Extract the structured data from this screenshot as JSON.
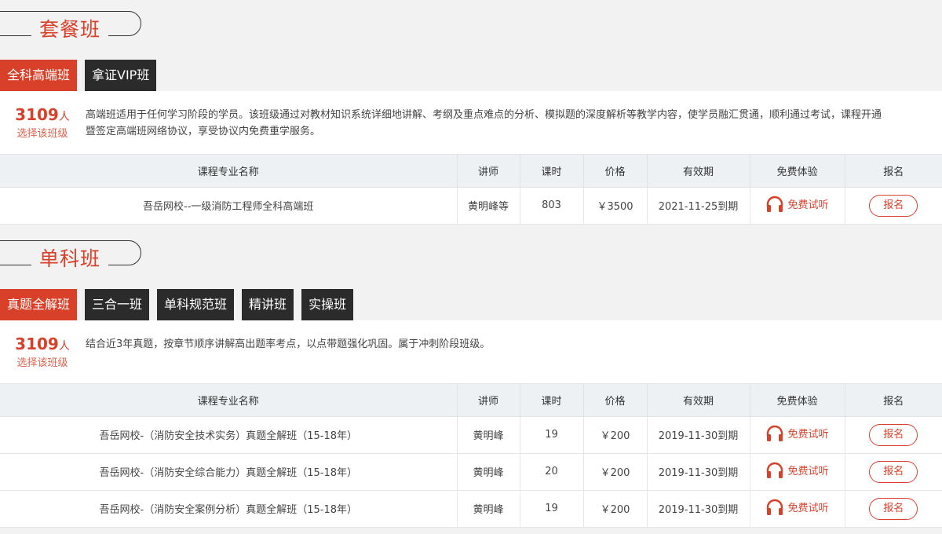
{
  "package_section": {
    "title": "套餐班",
    "tabs": [
      {
        "label": "全科高端班",
        "active": true
      },
      {
        "label": "拿证VIP班",
        "active": false
      }
    ],
    "count": "3109",
    "count_unit": "人",
    "count_sub": "选择该班级",
    "description": "高端班适用于任何学习阶段的学员。该班级通过对教材知识系统详细地讲解、考纲及重点难点的分析、模拟题的深度解析等教学内容，使学员融汇贯通，顺利通过考试，课程开通暨签定高端班网络协议，享受协议内免费重学服务。",
    "headers": [
      "课程专业名称",
      "讲师",
      "课时",
      "价格",
      "有效期",
      "免费体验",
      "报名"
    ],
    "rows": [
      {
        "name": "吾岳网校--一级消防工程师全科高端班",
        "teacher": "黄明峰等",
        "hours": "803",
        "price": "￥3500",
        "validity": "2021-11-25到期",
        "trial": "免费试听",
        "signup": "报名"
      }
    ]
  },
  "single_section": {
    "title": "单科班",
    "tabs": [
      {
        "label": "真题全解班",
        "active": true
      },
      {
        "label": "三合一班",
        "active": false
      },
      {
        "label": "单科规范班",
        "active": false
      },
      {
        "label": "精讲班",
        "active": false
      },
      {
        "label": "实操班",
        "active": false
      }
    ],
    "count": "3109",
    "count_unit": "人",
    "count_sub": "选择该班级",
    "description": "结合近3年真题，按章节顺序讲解高出题率考点，以点带题强化巩固。属于冲刺阶段班级。",
    "headers": [
      "课程专业名称",
      "讲师",
      "课时",
      "价格",
      "有效期",
      "免费体验",
      "报名"
    ],
    "rows": [
      {
        "name": "吾岳网校-（消防安全技术实务）真题全解班（15-18年）",
        "teacher": "黄明峰",
        "hours": "19",
        "price": "￥200",
        "validity": "2019-11-30到期",
        "trial": "免费试听",
        "signup": "报名"
      },
      {
        "name": "吾岳网校-（消防安全综合能力）真题全解班（15-18年）",
        "teacher": "黄明峰",
        "hours": "20",
        "price": "￥200",
        "validity": "2019-11-30到期",
        "trial": "免费试听",
        "signup": "报名"
      },
      {
        "name": "吾岳网校-（消防安全案例分析）真题全解班（15-18年）",
        "teacher": "黄明峰",
        "hours": "19",
        "price": "￥200",
        "validity": "2019-11-30到期",
        "trial": "免费试听",
        "signup": "报名"
      }
    ]
  },
  "icons": {
    "trial": "headphones-icon"
  },
  "colors": {
    "accent": "#d8402a",
    "dark_tab": "#2b2b2b",
    "header_bg": "#eef1f4",
    "page_bg": "#f2f2f2"
  }
}
